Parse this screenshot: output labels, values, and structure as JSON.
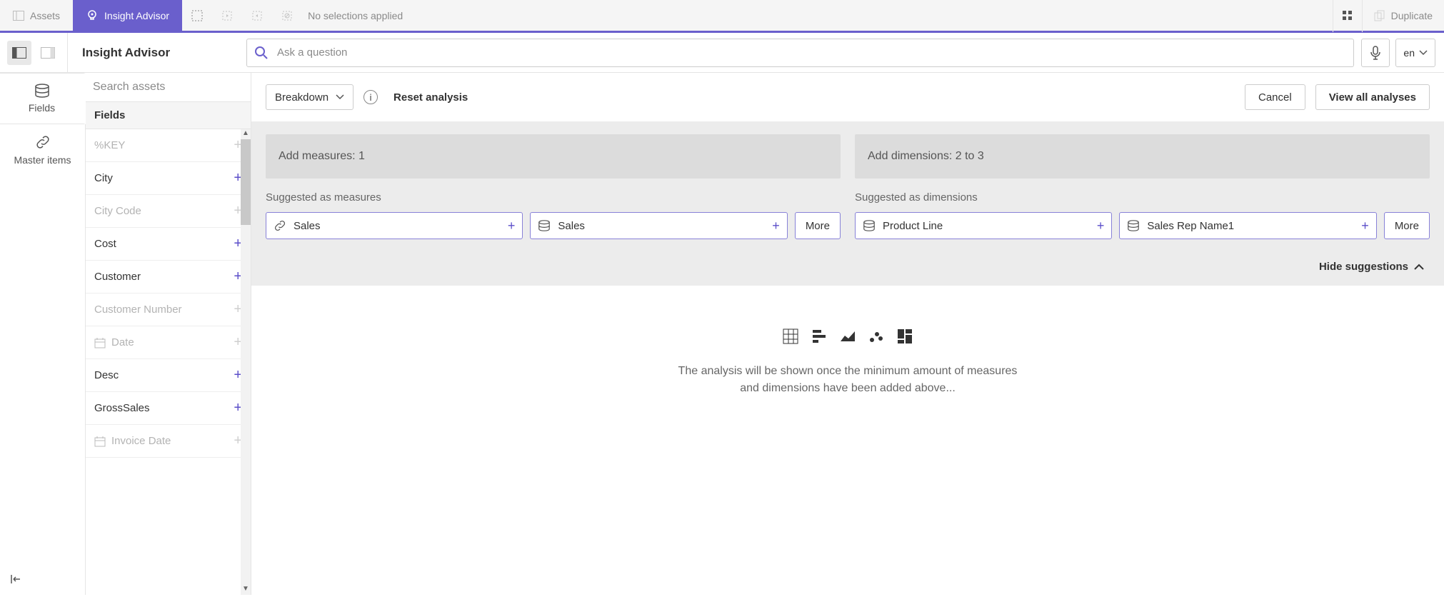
{
  "topbar": {
    "assets_label": "Assets",
    "insight_label": "Insight Advisor",
    "no_selections": "No selections applied",
    "duplicate_label": "Duplicate"
  },
  "subbar": {
    "title": "Insight Advisor",
    "search_placeholder": "Ask a question",
    "lang": "en"
  },
  "rail": {
    "fields": "Fields",
    "master_items": "Master items"
  },
  "assets_panel": {
    "search_placeholder": "Search assets",
    "header": "Fields",
    "fields": [
      {
        "label": "%KEY",
        "active": false,
        "icon": null
      },
      {
        "label": "City",
        "active": true,
        "icon": null
      },
      {
        "label": "City Code",
        "active": false,
        "icon": null
      },
      {
        "label": "Cost",
        "active": true,
        "icon": null
      },
      {
        "label": "Customer",
        "active": true,
        "icon": null
      },
      {
        "label": "Customer Number",
        "active": false,
        "icon": null
      },
      {
        "label": "Date",
        "active": false,
        "icon": "calendar"
      },
      {
        "label": "Desc",
        "active": true,
        "icon": null
      },
      {
        "label": "GrossSales",
        "active": true,
        "icon": null
      },
      {
        "label": "Invoice Date",
        "active": false,
        "icon": "calendar"
      }
    ]
  },
  "controls": {
    "breakdown": "Breakdown",
    "reset": "Reset analysis",
    "cancel": "Cancel",
    "view_all": "View all analyses"
  },
  "slots": {
    "measures_box": "Add measures: 1",
    "dimensions_box": "Add dimensions: 2 to 3",
    "suggested_measures_label": "Suggested as measures",
    "suggested_dimensions_label": "Suggested as dimensions",
    "more": "More",
    "measure_chips": [
      {
        "label": "Sales",
        "icon": "link"
      },
      {
        "label": "Sales",
        "icon": "db"
      }
    ],
    "dimension_chips": [
      {
        "label": "Product Line",
        "icon": "db"
      },
      {
        "label": "Sales Rep Name1",
        "icon": "db"
      }
    ]
  },
  "hide_suggestions": "Hide suggestions",
  "empty_message": "The analysis will be shown once the minimum amount of measures and dimensions have been added above..."
}
